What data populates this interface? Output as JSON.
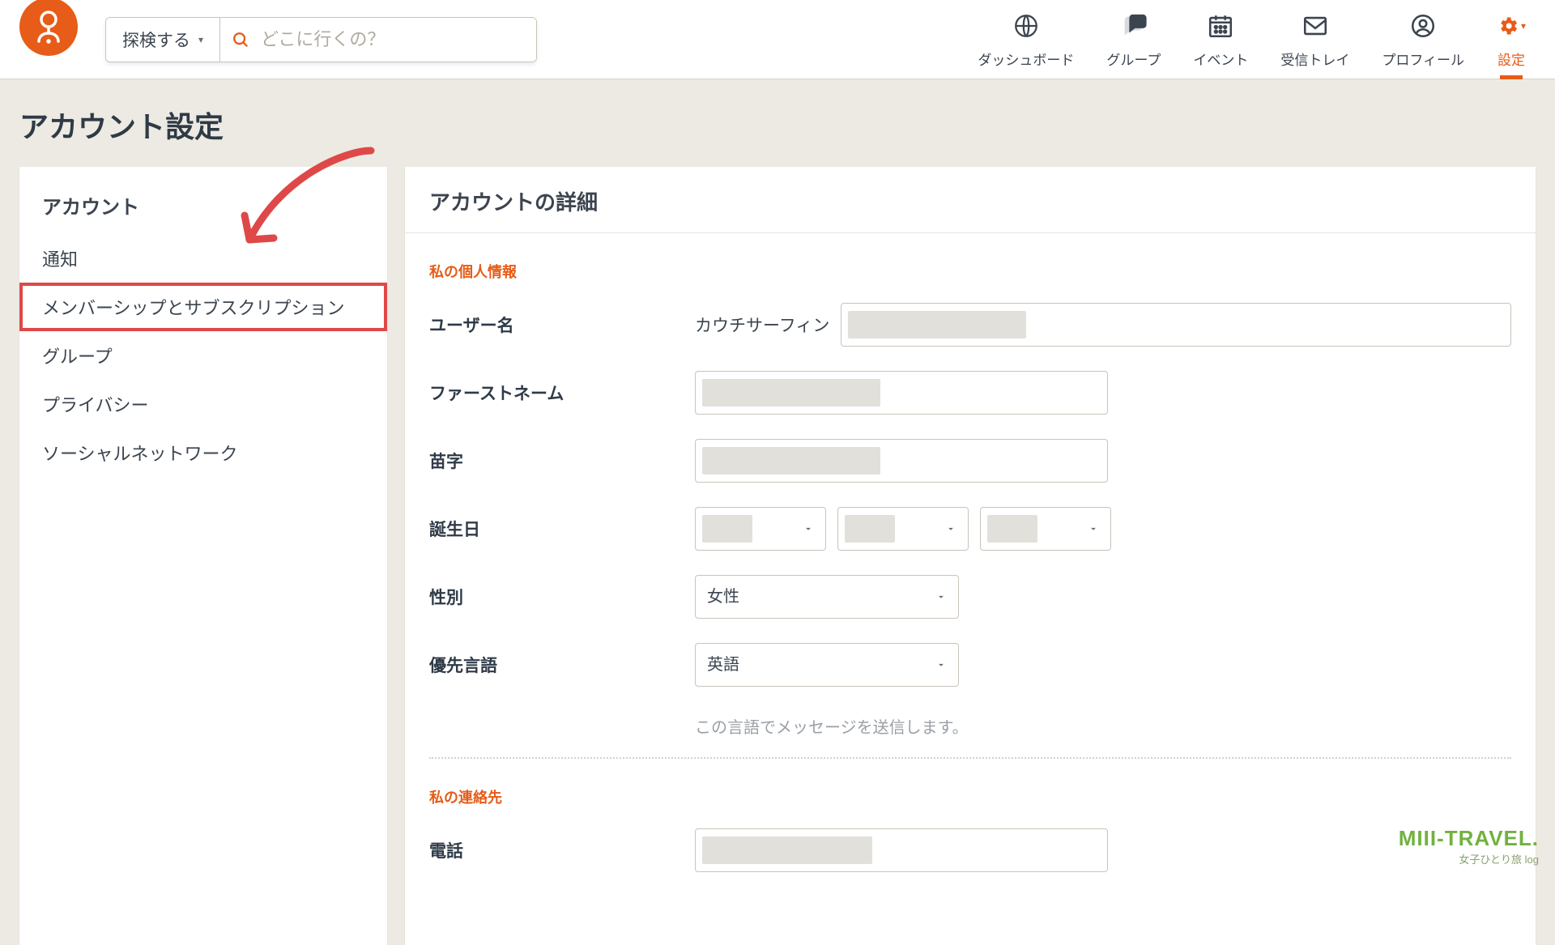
{
  "header": {
    "explore_label": "探検する",
    "search_placeholder": "どこに行くの？"
  },
  "nav": [
    {
      "id": "dashboard",
      "label": "ダッシュボード"
    },
    {
      "id": "groups",
      "label": "グループ"
    },
    {
      "id": "events",
      "label": "イベント"
    },
    {
      "id": "inbox",
      "label": "受信トレイ"
    },
    {
      "id": "profile",
      "label": "プロフィール"
    },
    {
      "id": "settings",
      "label": "設定"
    }
  ],
  "page_title": "アカウント設定",
  "sidebar": {
    "title": "アカウント",
    "items": [
      {
        "label": "通知"
      },
      {
        "label": "メンバーシップとサブスクリプション",
        "highlight": true
      },
      {
        "label": "グループ"
      },
      {
        "label": "プライバシー"
      },
      {
        "label": "ソーシャルネットワーク"
      }
    ]
  },
  "panel": {
    "heading": "アカウントの詳細",
    "section_personal": "私の個人情報",
    "section_contact": "私の連絡先",
    "fields": {
      "username_label": "ユーザー名",
      "username_prefix": "カウチサーフィン",
      "firstname_label": "ファーストネーム",
      "lastname_label": "苗字",
      "birthday_label": "誕生日",
      "gender_label": "性別",
      "gender_value": "女性",
      "language_label": "優先言語",
      "language_value": "英語",
      "language_helper": "この言語でメッセージを送信します。",
      "phone_label": "電話"
    }
  },
  "watermark": {
    "line1": "MIII-TRAVEL.",
    "line2": "女子ひとり旅 log"
  }
}
